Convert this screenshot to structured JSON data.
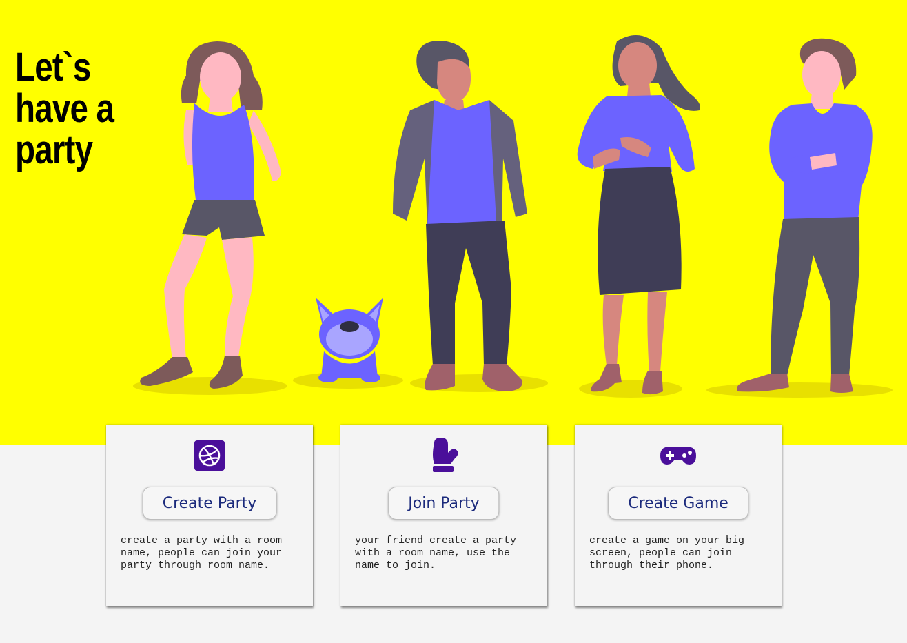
{
  "hero": {
    "headline_lines": [
      "Let`s",
      "have a",
      "party"
    ],
    "background_color": "#ffff00",
    "illustration": [
      "woman-in-tank-top",
      "dog",
      "man-in-blazer",
      "woman-in-skirt",
      "man-arms-crossed"
    ]
  },
  "accent_color": "#4a0f9a",
  "cards": [
    {
      "icon": "dribbble-square-icon",
      "button_label": "Create Party",
      "description": "create a party with a room name, people can join your party through room name."
    },
    {
      "icon": "mitten-icon",
      "button_label": "Join Party",
      "description": "your friend create a party with a room name, use the name to join."
    },
    {
      "icon": "gamepad-icon",
      "button_label": "Create Game",
      "description": "create a game on your big screen, people can join through their phone."
    }
  ]
}
